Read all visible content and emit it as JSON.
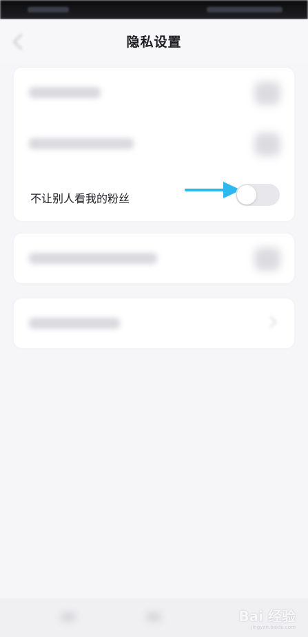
{
  "header": {
    "title": "隐私设置"
  },
  "settings": {
    "highlighted_item": {
      "label": "不让别人看我的粉丝",
      "toggle_on": false
    }
  },
  "watermark": {
    "text": "Bai 经验",
    "sub": "jingyan.baidu.com"
  },
  "colors": {
    "arrow": "#2db9ee",
    "toggle_off_track": "#e8e8ec",
    "background": "#f6f6f8"
  }
}
